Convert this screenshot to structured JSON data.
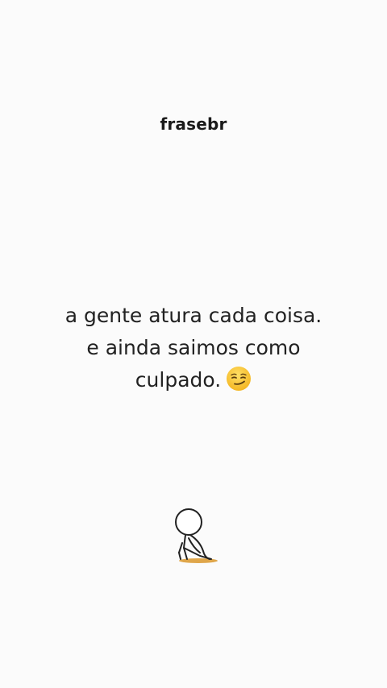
{
  "brand": {
    "name": "frasebr"
  },
  "quote": {
    "lines": [
      "a gente atura cada coisa.",
      "e ainda saimos como",
      "culpado."
    ],
    "emoji": "smirking-face"
  },
  "illustration": {
    "icon": "stick-figure-sitting-icon"
  },
  "colors": {
    "background": "#fbfbfb",
    "text": "#222222",
    "emoji": "#f7c12e",
    "shadow": "#d9962a"
  }
}
